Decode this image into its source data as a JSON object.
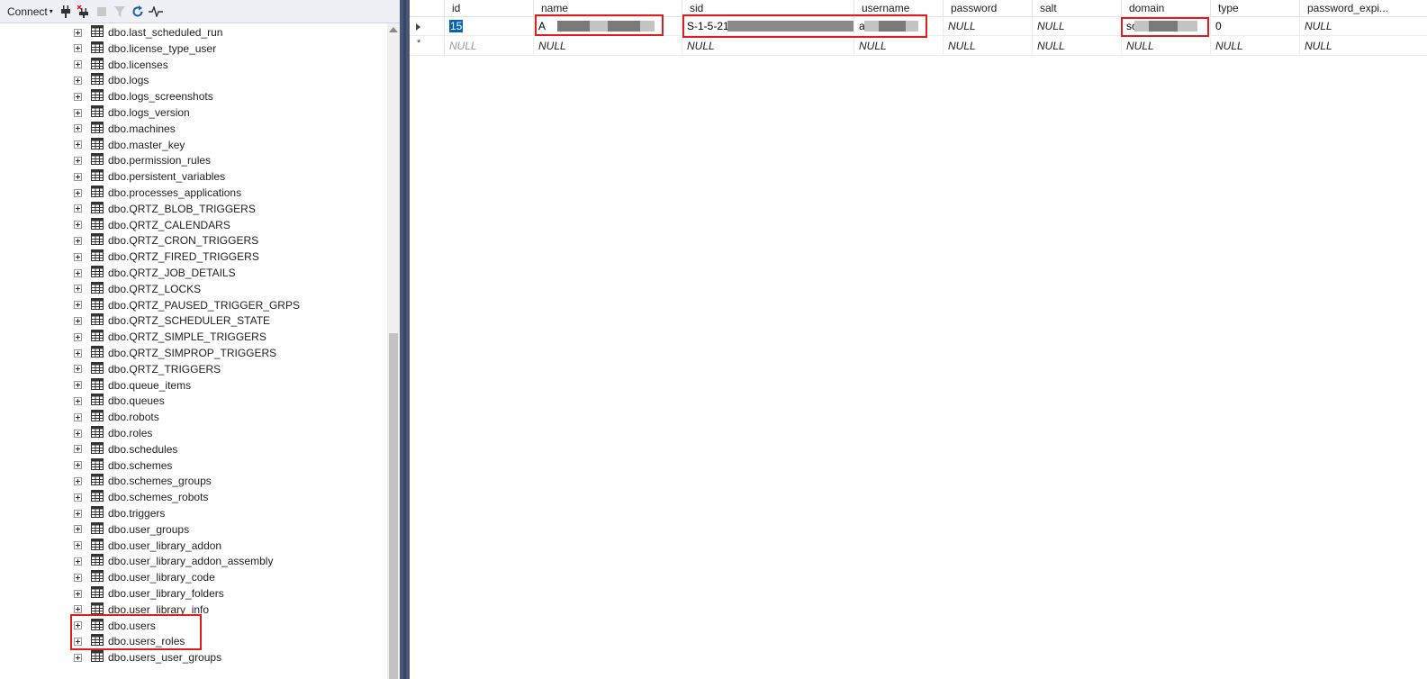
{
  "toolbar": {
    "connect_label": "Connect",
    "icons": [
      "connect-plug-icon",
      "disconnect-plug-icon",
      "stop-icon",
      "filter-icon",
      "refresh-icon",
      "activity-monitor-icon"
    ]
  },
  "tree": {
    "items": [
      {
        "label": "dbo.last_scheduled_run"
      },
      {
        "label": "dbo.license_type_user"
      },
      {
        "label": "dbo.licenses"
      },
      {
        "label": "dbo.logs"
      },
      {
        "label": "dbo.logs_screenshots"
      },
      {
        "label": "dbo.logs_version"
      },
      {
        "label": "dbo.machines"
      },
      {
        "label": "dbo.master_key"
      },
      {
        "label": "dbo.permission_rules"
      },
      {
        "label": "dbo.persistent_variables"
      },
      {
        "label": "dbo.processes_applications"
      },
      {
        "label": "dbo.QRTZ_BLOB_TRIGGERS"
      },
      {
        "label": "dbo.QRTZ_CALENDARS"
      },
      {
        "label": "dbo.QRTZ_CRON_TRIGGERS"
      },
      {
        "label": "dbo.QRTZ_FIRED_TRIGGERS"
      },
      {
        "label": "dbo.QRTZ_JOB_DETAILS"
      },
      {
        "label": "dbo.QRTZ_LOCKS"
      },
      {
        "label": "dbo.QRTZ_PAUSED_TRIGGER_GRPS"
      },
      {
        "label": "dbo.QRTZ_SCHEDULER_STATE"
      },
      {
        "label": "dbo.QRTZ_SIMPLE_TRIGGERS"
      },
      {
        "label": "dbo.QRTZ_SIMPROP_TRIGGERS"
      },
      {
        "label": "dbo.QRTZ_TRIGGERS"
      },
      {
        "label": "dbo.queue_items"
      },
      {
        "label": "dbo.queues"
      },
      {
        "label": "dbo.robots"
      },
      {
        "label": "dbo.roles"
      },
      {
        "label": "dbo.schedules"
      },
      {
        "label": "dbo.schemes"
      },
      {
        "label": "dbo.schemes_groups"
      },
      {
        "label": "dbo.schemes_robots"
      },
      {
        "label": "dbo.triggers"
      },
      {
        "label": "dbo.user_groups"
      },
      {
        "label": "dbo.user_library_addon"
      },
      {
        "label": "dbo.user_library_addon_assembly"
      },
      {
        "label": "dbo.user_library_code"
      },
      {
        "label": "dbo.user_library_folders"
      },
      {
        "label": "dbo.user_library_info"
      },
      {
        "label": "dbo.users"
      },
      {
        "label": "dbo.users_roles"
      },
      {
        "label": "dbo.users_user_groups"
      }
    ]
  },
  "grid": {
    "columns": [
      "id",
      "name",
      "sid",
      "username",
      "password",
      "salt",
      "domain",
      "type",
      "password_expi..."
    ],
    "row1": {
      "id": "15",
      "name": "A",
      "sid": "S-1-5-21-",
      "username": "a",
      "password": "NULL",
      "salt": "NULL",
      "domain": "sc",
      "type": "0",
      "password_expi": "NULL"
    },
    "new_row": {
      "id": "NULL",
      "name": "NULL",
      "sid": "NULL",
      "username": "NULL",
      "password": "NULL",
      "salt": "NULL",
      "domain": "NULL",
      "type": "NULL",
      "password_expi": "NULL"
    }
  },
  "colors": {
    "highlight_box": "#e01d1d",
    "selection": "#0a64ad",
    "splitter": "#4a5578",
    "redaction_dark": "#7a7a7a",
    "redaction_light": "#c4c4c4"
  }
}
